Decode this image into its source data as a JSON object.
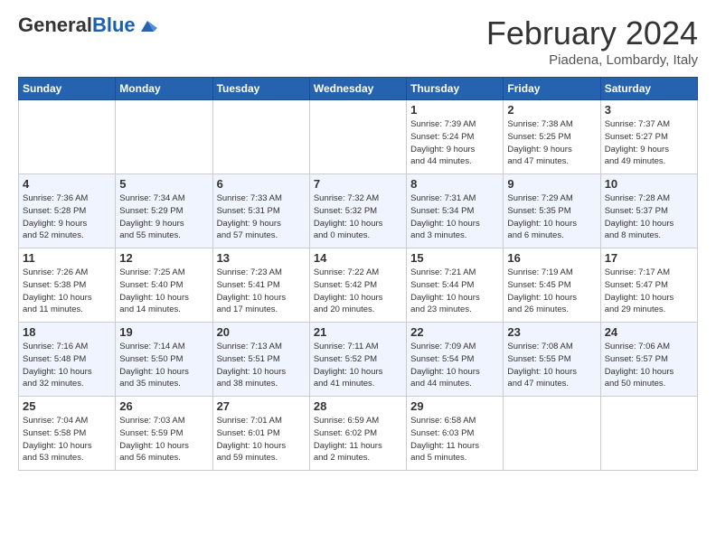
{
  "header": {
    "logo_line1": "General",
    "logo_line2": "Blue",
    "month_year": "February 2024",
    "location": "Piadena, Lombardy, Italy"
  },
  "weekdays": [
    "Sunday",
    "Monday",
    "Tuesday",
    "Wednesday",
    "Thursday",
    "Friday",
    "Saturday"
  ],
  "weeks": [
    [
      {
        "day": "",
        "info": ""
      },
      {
        "day": "",
        "info": ""
      },
      {
        "day": "",
        "info": ""
      },
      {
        "day": "",
        "info": ""
      },
      {
        "day": "1",
        "info": "Sunrise: 7:39 AM\nSunset: 5:24 PM\nDaylight: 9 hours\nand 44 minutes."
      },
      {
        "day": "2",
        "info": "Sunrise: 7:38 AM\nSunset: 5:25 PM\nDaylight: 9 hours\nand 47 minutes."
      },
      {
        "day": "3",
        "info": "Sunrise: 7:37 AM\nSunset: 5:27 PM\nDaylight: 9 hours\nand 49 minutes."
      }
    ],
    [
      {
        "day": "4",
        "info": "Sunrise: 7:36 AM\nSunset: 5:28 PM\nDaylight: 9 hours\nand 52 minutes."
      },
      {
        "day": "5",
        "info": "Sunrise: 7:34 AM\nSunset: 5:29 PM\nDaylight: 9 hours\nand 55 minutes."
      },
      {
        "day": "6",
        "info": "Sunrise: 7:33 AM\nSunset: 5:31 PM\nDaylight: 9 hours\nand 57 minutes."
      },
      {
        "day": "7",
        "info": "Sunrise: 7:32 AM\nSunset: 5:32 PM\nDaylight: 10 hours\nand 0 minutes."
      },
      {
        "day": "8",
        "info": "Sunrise: 7:31 AM\nSunset: 5:34 PM\nDaylight: 10 hours\nand 3 minutes."
      },
      {
        "day": "9",
        "info": "Sunrise: 7:29 AM\nSunset: 5:35 PM\nDaylight: 10 hours\nand 6 minutes."
      },
      {
        "day": "10",
        "info": "Sunrise: 7:28 AM\nSunset: 5:37 PM\nDaylight: 10 hours\nand 8 minutes."
      }
    ],
    [
      {
        "day": "11",
        "info": "Sunrise: 7:26 AM\nSunset: 5:38 PM\nDaylight: 10 hours\nand 11 minutes."
      },
      {
        "day": "12",
        "info": "Sunrise: 7:25 AM\nSunset: 5:40 PM\nDaylight: 10 hours\nand 14 minutes."
      },
      {
        "day": "13",
        "info": "Sunrise: 7:23 AM\nSunset: 5:41 PM\nDaylight: 10 hours\nand 17 minutes."
      },
      {
        "day": "14",
        "info": "Sunrise: 7:22 AM\nSunset: 5:42 PM\nDaylight: 10 hours\nand 20 minutes."
      },
      {
        "day": "15",
        "info": "Sunrise: 7:21 AM\nSunset: 5:44 PM\nDaylight: 10 hours\nand 23 minutes."
      },
      {
        "day": "16",
        "info": "Sunrise: 7:19 AM\nSunset: 5:45 PM\nDaylight: 10 hours\nand 26 minutes."
      },
      {
        "day": "17",
        "info": "Sunrise: 7:17 AM\nSunset: 5:47 PM\nDaylight: 10 hours\nand 29 minutes."
      }
    ],
    [
      {
        "day": "18",
        "info": "Sunrise: 7:16 AM\nSunset: 5:48 PM\nDaylight: 10 hours\nand 32 minutes."
      },
      {
        "day": "19",
        "info": "Sunrise: 7:14 AM\nSunset: 5:50 PM\nDaylight: 10 hours\nand 35 minutes."
      },
      {
        "day": "20",
        "info": "Sunrise: 7:13 AM\nSunset: 5:51 PM\nDaylight: 10 hours\nand 38 minutes."
      },
      {
        "day": "21",
        "info": "Sunrise: 7:11 AM\nSunset: 5:52 PM\nDaylight: 10 hours\nand 41 minutes."
      },
      {
        "day": "22",
        "info": "Sunrise: 7:09 AM\nSunset: 5:54 PM\nDaylight: 10 hours\nand 44 minutes."
      },
      {
        "day": "23",
        "info": "Sunrise: 7:08 AM\nSunset: 5:55 PM\nDaylight: 10 hours\nand 47 minutes."
      },
      {
        "day": "24",
        "info": "Sunrise: 7:06 AM\nSunset: 5:57 PM\nDaylight: 10 hours\nand 50 minutes."
      }
    ],
    [
      {
        "day": "25",
        "info": "Sunrise: 7:04 AM\nSunset: 5:58 PM\nDaylight: 10 hours\nand 53 minutes."
      },
      {
        "day": "26",
        "info": "Sunrise: 7:03 AM\nSunset: 5:59 PM\nDaylight: 10 hours\nand 56 minutes."
      },
      {
        "day": "27",
        "info": "Sunrise: 7:01 AM\nSunset: 6:01 PM\nDaylight: 10 hours\nand 59 minutes."
      },
      {
        "day": "28",
        "info": "Sunrise: 6:59 AM\nSunset: 6:02 PM\nDaylight: 11 hours\nand 2 minutes."
      },
      {
        "day": "29",
        "info": "Sunrise: 6:58 AM\nSunset: 6:03 PM\nDaylight: 11 hours\nand 5 minutes."
      },
      {
        "day": "",
        "info": ""
      },
      {
        "day": "",
        "info": ""
      }
    ]
  ]
}
